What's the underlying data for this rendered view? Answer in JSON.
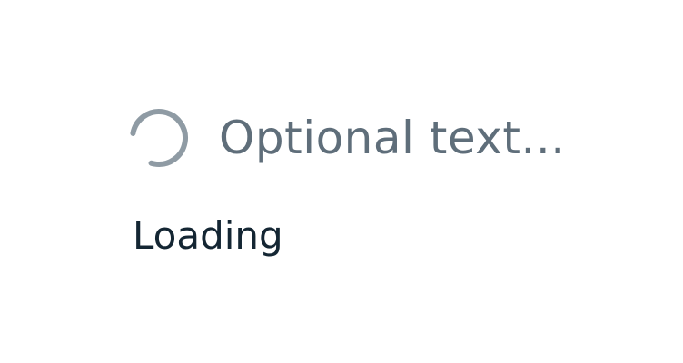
{
  "loader": {
    "icon": "spinner-icon",
    "optional_text": "Optional text..."
  },
  "caption": {
    "label": "Loading"
  },
  "colors": {
    "spinner": "#8f9ba4",
    "optional_text": "#5f6e7a",
    "caption": "#142633",
    "background": "#ffffff"
  }
}
